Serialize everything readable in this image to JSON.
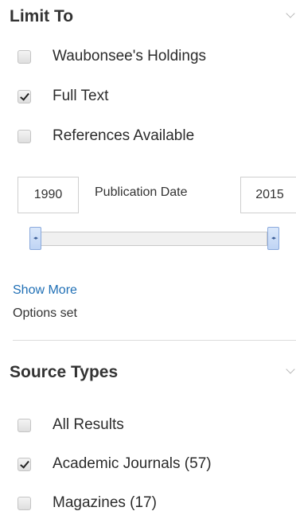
{
  "limit_to": {
    "title": "Limit To",
    "options": [
      {
        "label": "Waubonsee's Holdings",
        "checked": false
      },
      {
        "label": "Full Text",
        "checked": true
      },
      {
        "label": "References Available",
        "checked": false
      }
    ],
    "publication_date": {
      "label": "Publication Date",
      "from": "1990",
      "to": "2015"
    },
    "show_more": "Show More",
    "options_set": "Options set"
  },
  "source_types": {
    "title": "Source Types",
    "options": [
      {
        "label": "All Results",
        "checked": false
      },
      {
        "label": "Academic Journals (57)",
        "checked": true
      },
      {
        "label": "Magazines (17)",
        "checked": false
      }
    ]
  },
  "icons": {
    "collapse": "chevron-down-icon",
    "slider_handle": "left-right-arrows-icon",
    "checkmark": "check-icon"
  },
  "colors": {
    "link": "#1f6fb5",
    "slider_handle": "#bfd4f4",
    "heading": "#333333"
  }
}
